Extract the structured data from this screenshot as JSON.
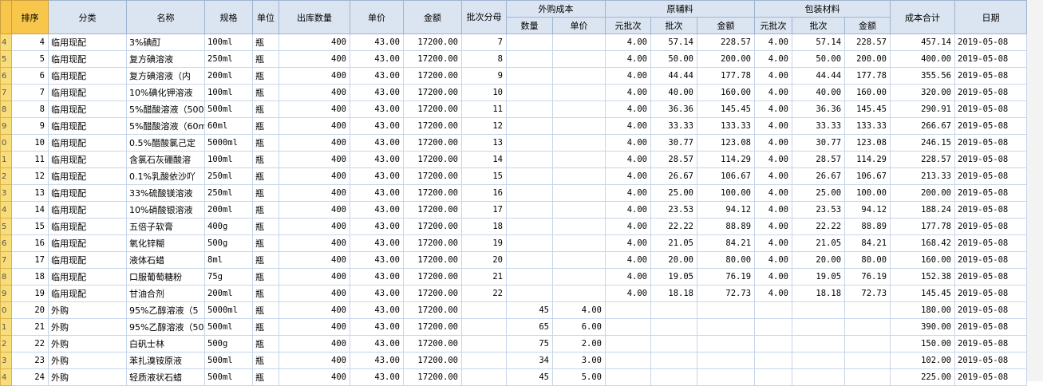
{
  "headers": {
    "sort": "排序",
    "category": "分类",
    "name": "名称",
    "spec": "规格",
    "unit": "单位",
    "out_qty": "出库数量",
    "price": "单价",
    "amount": "金额",
    "batch_split": "批次分母",
    "outsource_cost": "外购成本",
    "outsource_qty": "数量",
    "outsource_price": "单价",
    "raw_material": "原辅料",
    "raw_unit_batch": "元批次",
    "raw_batch": "批次",
    "raw_amount": "金额",
    "packaging": "包装材料",
    "pack_unit_batch": "元批次",
    "pack_batch": "批次",
    "pack_amount": "金额",
    "total_cost": "成本合计",
    "date": "日期"
  },
  "rows": [
    {
      "rh": "4",
      "sort": "4",
      "cat": "临用现配",
      "name": "3%碘酊",
      "spec": "100ml",
      "unit": "瓶",
      "qty": "400",
      "price": "43.00",
      "amount": "17200.00",
      "bd": "7",
      "oq": "",
      "op": "",
      "ru": "4.00",
      "rb": "57.14",
      "ra": "228.57",
      "pu": "4.00",
      "pb": "57.14",
      "pa": "228.57",
      "total": "457.14",
      "date": "2019-05-08"
    },
    {
      "rh": "5",
      "sort": "5",
      "cat": "临用现配",
      "name": "复方碘溶液",
      "spec": "250ml",
      "unit": "瓶",
      "qty": "400",
      "price": "43.00",
      "amount": "17200.00",
      "bd": "8",
      "oq": "",
      "op": "",
      "ru": "4.00",
      "rb": "50.00",
      "ra": "200.00",
      "pu": "4.00",
      "pb": "50.00",
      "pa": "200.00",
      "total": "400.00",
      "date": "2019-05-08"
    },
    {
      "rh": "6",
      "sort": "6",
      "cat": "临用现配",
      "name": "复方碘溶液（内",
      "spec": "200ml",
      "unit": "瓶",
      "qty": "400",
      "price": "43.00",
      "amount": "17200.00",
      "bd": "9",
      "oq": "",
      "op": "",
      "ru": "4.00",
      "rb": "44.44",
      "ra": "177.78",
      "pu": "4.00",
      "pb": "44.44",
      "pa": "177.78",
      "total": "355.56",
      "date": "2019-05-08"
    },
    {
      "rh": "7",
      "sort": "7",
      "cat": "临用现配",
      "name": "10%碘化钾溶液",
      "spec": "100ml",
      "unit": "瓶",
      "qty": "400",
      "price": "43.00",
      "amount": "17200.00",
      "bd": "10",
      "oq": "",
      "op": "",
      "ru": "4.00",
      "rb": "40.00",
      "ra": "160.00",
      "pu": "4.00",
      "pb": "40.00",
      "pa": "160.00",
      "total": "320.00",
      "date": "2019-05-08"
    },
    {
      "rh": "8",
      "sort": "8",
      "cat": "临用现配",
      "name": "5%醋酸溶液（500",
      "spec": "500ml",
      "unit": "瓶",
      "qty": "400",
      "price": "43.00",
      "amount": "17200.00",
      "bd": "11",
      "oq": "",
      "op": "",
      "ru": "4.00",
      "rb": "36.36",
      "ra": "145.45",
      "pu": "4.00",
      "pb": "36.36",
      "pa": "145.45",
      "total": "290.91",
      "date": "2019-05-08"
    },
    {
      "rh": "9",
      "sort": "9",
      "cat": "临用现配",
      "name": "5%醋酸溶液（60m",
      "spec": "60ml",
      "unit": "瓶",
      "qty": "400",
      "price": "43.00",
      "amount": "17200.00",
      "bd": "12",
      "oq": "",
      "op": "",
      "ru": "4.00",
      "rb": "33.33",
      "ra": "133.33",
      "pu": "4.00",
      "pb": "33.33",
      "pa": "133.33",
      "total": "266.67",
      "date": "2019-05-08"
    },
    {
      "rh": "0",
      "sort": "10",
      "cat": "临用现配",
      "name": "0.5%醋酸氯己定",
      "spec": "5000ml",
      "unit": "瓶",
      "qty": "400",
      "price": "43.00",
      "amount": "17200.00",
      "bd": "13",
      "oq": "",
      "op": "",
      "ru": "4.00",
      "rb": "30.77",
      "ra": "123.08",
      "pu": "4.00",
      "pb": "30.77",
      "pa": "123.08",
      "total": "246.15",
      "date": "2019-05-08"
    },
    {
      "rh": "1",
      "sort": "11",
      "cat": "临用现配",
      "name": "含氯石灰硼酸溶",
      "spec": "100ml",
      "unit": "瓶",
      "qty": "400",
      "price": "43.00",
      "amount": "17200.00",
      "bd": "14",
      "oq": "",
      "op": "",
      "ru": "4.00",
      "rb": "28.57",
      "ra": "114.29",
      "pu": "4.00",
      "pb": "28.57",
      "pa": "114.29",
      "total": "228.57",
      "date": "2019-05-08"
    },
    {
      "rh": "2",
      "sort": "12",
      "cat": "临用现配",
      "name": "0.1%乳酸依沙吖",
      "spec": "250ml",
      "unit": "瓶",
      "qty": "400",
      "price": "43.00",
      "amount": "17200.00",
      "bd": "15",
      "oq": "",
      "op": "",
      "ru": "4.00",
      "rb": "26.67",
      "ra": "106.67",
      "pu": "4.00",
      "pb": "26.67",
      "pa": "106.67",
      "total": "213.33",
      "date": "2019-05-08"
    },
    {
      "rh": "3",
      "sort": "13",
      "cat": "临用现配",
      "name": "33%硫酸镁溶液",
      "spec": "250ml",
      "unit": "瓶",
      "qty": "400",
      "price": "43.00",
      "amount": "17200.00",
      "bd": "16",
      "oq": "",
      "op": "",
      "ru": "4.00",
      "rb": "25.00",
      "ra": "100.00",
      "pu": "4.00",
      "pb": "25.00",
      "pa": "100.00",
      "total": "200.00",
      "date": "2019-05-08"
    },
    {
      "rh": "4",
      "sort": "14",
      "cat": "临用现配",
      "name": "10%硝酸银溶液",
      "spec": "200ml",
      "unit": "瓶",
      "qty": "400",
      "price": "43.00",
      "amount": "17200.00",
      "bd": "17",
      "oq": "",
      "op": "",
      "ru": "4.00",
      "rb": "23.53",
      "ra": "94.12",
      "pu": "4.00",
      "pb": "23.53",
      "pa": "94.12",
      "total": "188.24",
      "date": "2019-05-08"
    },
    {
      "rh": "5",
      "sort": "15",
      "cat": "临用现配",
      "name": "五倍子软膏",
      "spec": "400g",
      "unit": "瓶",
      "qty": "400",
      "price": "43.00",
      "amount": "17200.00",
      "bd": "18",
      "oq": "",
      "op": "",
      "ru": "4.00",
      "rb": "22.22",
      "ra": "88.89",
      "pu": "4.00",
      "pb": "22.22",
      "pa": "88.89",
      "total": "177.78",
      "date": "2019-05-08"
    },
    {
      "rh": "6",
      "sort": "16",
      "cat": "临用现配",
      "name": "氧化锌糊",
      "spec": "500g",
      "unit": "瓶",
      "qty": "400",
      "price": "43.00",
      "amount": "17200.00",
      "bd": "19",
      "oq": "",
      "op": "",
      "ru": "4.00",
      "rb": "21.05",
      "ra": "84.21",
      "pu": "4.00",
      "pb": "21.05",
      "pa": "84.21",
      "total": "168.42",
      "date": "2019-05-08"
    },
    {
      "rh": "7",
      "sort": "17",
      "cat": "临用现配",
      "name": "液体石蜡",
      "spec": "8ml",
      "unit": "瓶",
      "qty": "400",
      "price": "43.00",
      "amount": "17200.00",
      "bd": "20",
      "oq": "",
      "op": "",
      "ru": "4.00",
      "rb": "20.00",
      "ra": "80.00",
      "pu": "4.00",
      "pb": "20.00",
      "pa": "80.00",
      "total": "160.00",
      "date": "2019-05-08"
    },
    {
      "rh": "8",
      "sort": "18",
      "cat": "临用现配",
      "name": "口服葡萄糖粉",
      "spec": "75g",
      "unit": "瓶",
      "qty": "400",
      "price": "43.00",
      "amount": "17200.00",
      "bd": "21",
      "oq": "",
      "op": "",
      "ru": "4.00",
      "rb": "19.05",
      "ra": "76.19",
      "pu": "4.00",
      "pb": "19.05",
      "pa": "76.19",
      "total": "152.38",
      "date": "2019-05-08"
    },
    {
      "rh": "9",
      "sort": "19",
      "cat": "临用现配",
      "name": "甘油合剂",
      "spec": "200ml",
      "unit": "瓶",
      "qty": "400",
      "price": "43.00",
      "amount": "17200.00",
      "bd": "22",
      "oq": "",
      "op": "",
      "ru": "4.00",
      "rb": "18.18",
      "ra": "72.73",
      "pu": "4.00",
      "pb": "18.18",
      "pa": "72.73",
      "total": "145.45",
      "date": "2019-05-08"
    },
    {
      "rh": "0",
      "sort": "20",
      "cat": "外购",
      "name": "95%乙醇溶液（5",
      "spec": "5000ml",
      "unit": "瓶",
      "qty": "400",
      "price": "43.00",
      "amount": "17200.00",
      "bd": "",
      "oq": "45",
      "op": "4.00",
      "ru": "",
      "rb": "",
      "ra": "",
      "pu": "",
      "pb": "",
      "pa": "",
      "total": "180.00",
      "date": "2019-05-08"
    },
    {
      "rh": "1",
      "sort": "21",
      "cat": "外购",
      "name": "95%乙醇溶液（50",
      "spec": "500ml",
      "unit": "瓶",
      "qty": "400",
      "price": "43.00",
      "amount": "17200.00",
      "bd": "",
      "oq": "65",
      "op": "6.00",
      "ru": "",
      "rb": "",
      "ra": "",
      "pu": "",
      "pb": "",
      "pa": "",
      "total": "390.00",
      "date": "2019-05-08"
    },
    {
      "rh": "2",
      "sort": "22",
      "cat": "外购",
      "name": "白矾士林",
      "spec": "500g",
      "unit": "瓶",
      "qty": "400",
      "price": "43.00",
      "amount": "17200.00",
      "bd": "",
      "oq": "75",
      "op": "2.00",
      "ru": "",
      "rb": "",
      "ra": "",
      "pu": "",
      "pb": "",
      "pa": "",
      "total": "150.00",
      "date": "2019-05-08"
    },
    {
      "rh": "3",
      "sort": "23",
      "cat": "外购",
      "name": "苯扎溴铵原液",
      "spec": "500ml",
      "unit": "瓶",
      "qty": "400",
      "price": "43.00",
      "amount": "17200.00",
      "bd": "",
      "oq": "34",
      "op": "3.00",
      "ru": "",
      "rb": "",
      "ra": "",
      "pu": "",
      "pb": "",
      "pa": "",
      "total": "102.00",
      "date": "2019-05-08"
    },
    {
      "rh": "4",
      "sort": "24",
      "cat": "外购",
      "name": "轻质液状石蜡",
      "spec": "500ml",
      "unit": "瓶",
      "qty": "400",
      "price": "43.00",
      "amount": "17200.00",
      "bd": "",
      "oq": "45",
      "op": "5.00",
      "ru": "",
      "rb": "",
      "ra": "",
      "pu": "",
      "pb": "",
      "pa": "",
      "total": "225.00",
      "date": "2019-05-08"
    }
  ]
}
